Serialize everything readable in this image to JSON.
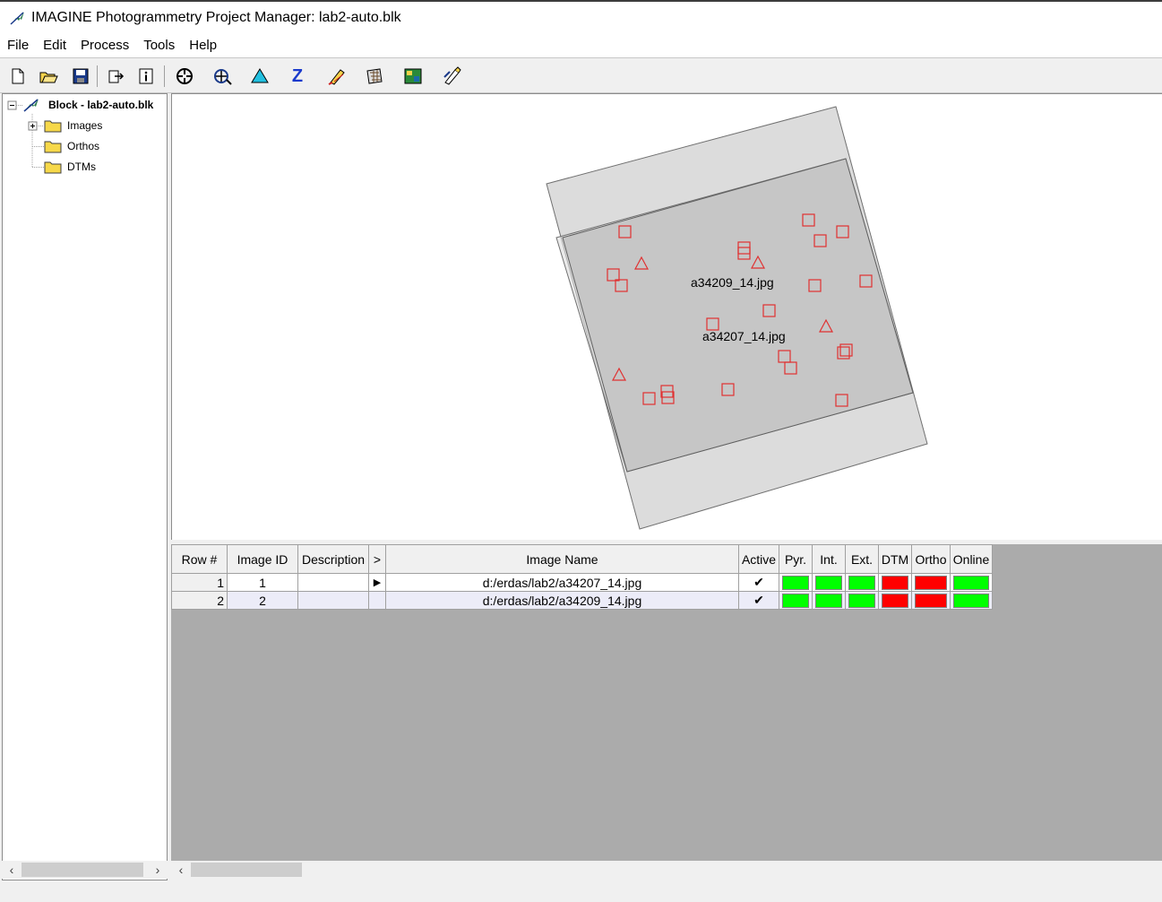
{
  "window": {
    "title": "IMAGINE Photogrammetry Project Manager: lab2-auto.blk"
  },
  "menu": [
    "File",
    "Edit",
    "Process",
    "Tools",
    "Help"
  ],
  "toolbar": {
    "buttons": [
      "new-file-icon",
      "open-folder-icon",
      "save-icon",
      "export-icon",
      "info-icon",
      "point-measure-icon",
      "auto-tie-icon",
      "triangulation-icon",
      "z-dtm-icon",
      "edit-pencil-icon",
      "mosaic-icon",
      "ortho-icon",
      "feature-collect-icon"
    ]
  },
  "tree": {
    "root": "Block - lab2-auto.blk",
    "children": [
      "Images",
      "Orthos",
      "DTMs"
    ]
  },
  "canvas": {
    "image_labels": [
      "a34209_14.jpg",
      "a34207_14.jpg"
    ]
  },
  "grid": {
    "headers": [
      "Row #",
      "Image ID",
      "Description",
      ">",
      "Image Name",
      "Active",
      "Pyr.",
      "Int.",
      "Ext.",
      "DTM",
      "Ortho",
      "Online"
    ],
    "rows": [
      {
        "row": "1",
        "image_id": "1",
        "description": "",
        "pointer": "▶",
        "image_name": "d:/erdas/lab2/a34207_14.jpg",
        "active": "✔",
        "pyr": "green",
        "int": "green",
        "ext": "green",
        "dtm": "red",
        "ortho": "red",
        "online": "green"
      },
      {
        "row": "2",
        "image_id": "2",
        "description": "",
        "pointer": "",
        "image_name": "d:/erdas/lab2/a34209_14.jpg",
        "active": "✔",
        "pyr": "green",
        "int": "green",
        "ext": "green",
        "dtm": "red",
        "ortho": "red",
        "online": "green"
      }
    ]
  },
  "colors": {
    "status_green": "#00ff00",
    "status_red": "#ff0000",
    "marker_red": "#e03030",
    "footprint_fill": "#dcdcdc",
    "overlap_fill": "#c8c8c8"
  }
}
